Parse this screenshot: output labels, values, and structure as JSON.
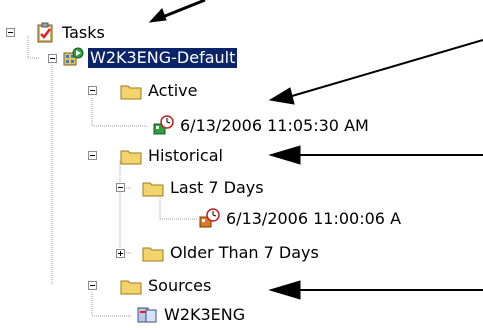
{
  "tree": {
    "root": {
      "label": "Tasks",
      "icon": "clipboard-check-icon",
      "expanded": true
    },
    "server": {
      "label": "W2K3ENG-Default",
      "icon": "server-config-icon",
      "expanded": true,
      "selected": true
    },
    "active": {
      "label": "Active",
      "icon": "folder-icon",
      "expanded": true
    },
    "active_task": {
      "label": "6/13/2006 11:05:30 AM",
      "icon": "scheduled-task-icon"
    },
    "historical": {
      "label": "Historical",
      "icon": "folder-icon",
      "expanded": true
    },
    "last7": {
      "label": "Last 7 Days",
      "icon": "folder-icon",
      "expanded": true
    },
    "last7_task": {
      "label": "6/13/2006 11:00:06 A",
      "icon": "scheduled-task-icon"
    },
    "older": {
      "label": "Older Than 7 Days",
      "icon": "folder-icon",
      "expanded": false
    },
    "sources": {
      "label": "Sources",
      "icon": "folder-icon",
      "expanded": true
    },
    "source_item": {
      "label": "W2K3ENG",
      "icon": "computer-source-icon"
    }
  },
  "colors": {
    "selection_bg": "#0a246a",
    "selection_text": "#ffffff",
    "folder_yellow": "#f3d36b",
    "tree_line": "#a0a0a0"
  }
}
